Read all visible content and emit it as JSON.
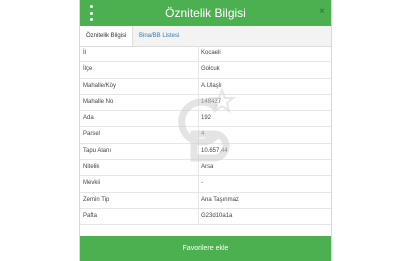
{
  "header": {
    "title": "Öznitelik Bilgisi",
    "menu_icon": "more-vertical-icon",
    "close_icon": "close-icon",
    "close_symbol": "×",
    "color": "#4caf50"
  },
  "tabs": [
    {
      "label": "Öznitelik Bilgisi",
      "active": true
    },
    {
      "label": "Bina/BB Listesi",
      "active": false
    }
  ],
  "rows": [
    {
      "label": "İl",
      "value": "Kocaeli"
    },
    {
      "label": "İlçe",
      "value": "Golcuk"
    },
    {
      "label": "Mahalle/Köy",
      "value": "A.Ulaşlı"
    },
    {
      "label": "Mahalle No",
      "value": "148427"
    },
    {
      "label": "Ada",
      "value": "192"
    },
    {
      "label": "Parsel",
      "value": "4"
    },
    {
      "label": "Tapu Alanı",
      "value": "10.657,44"
    },
    {
      "label": "Nitelik",
      "value": "Arsa"
    },
    {
      "label": "Mevkii",
      "value": "-"
    },
    {
      "label": "Zemin Tip",
      "value": "Ana Taşınmaz"
    },
    {
      "label": "Pafta",
      "value": "G23d10a1a"
    }
  ],
  "watermark": {
    "icon": "logo-watermark-icon"
  },
  "footer": {
    "button_label": "Favorilere ekle"
  }
}
